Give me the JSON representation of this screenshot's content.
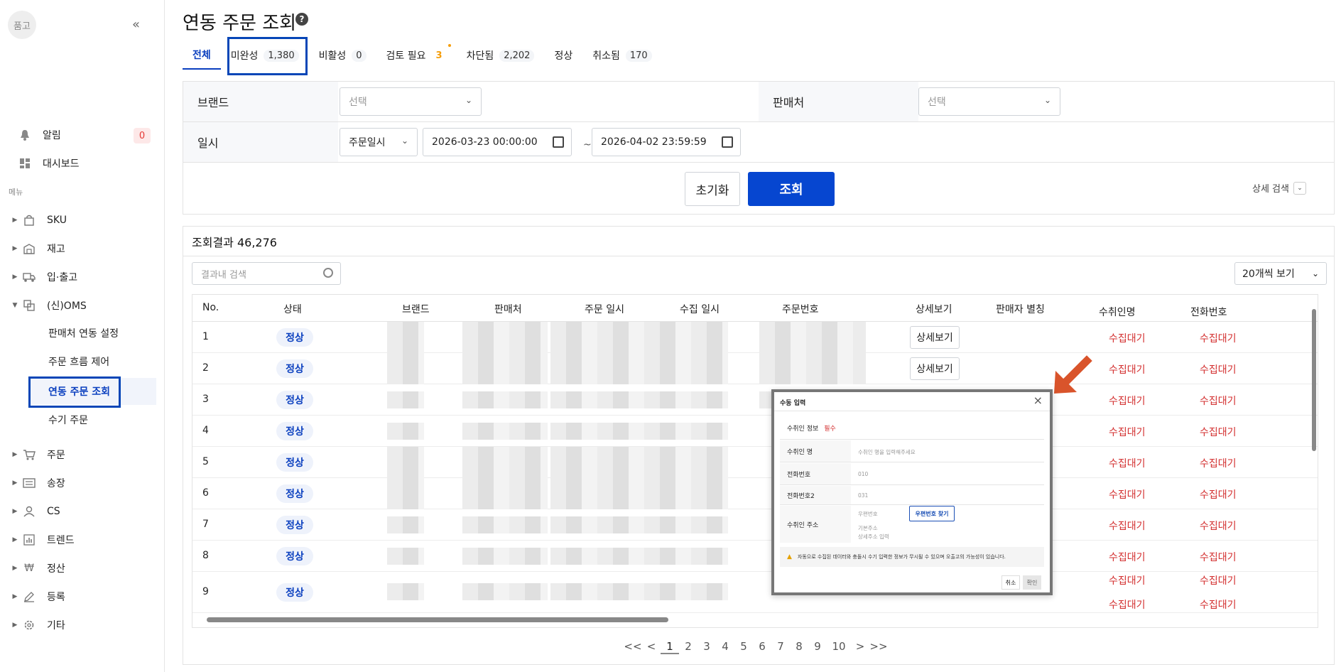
{
  "sidebar": {
    "logo": "품고",
    "collapse_label": "«",
    "alarm_label": "알림",
    "alarm_count": "0",
    "dashboard_label": "대시보드",
    "section_label": "메뉴",
    "items": [
      {
        "label": "SKU"
      },
      {
        "label": "재고"
      },
      {
        "label": "입·출고"
      },
      {
        "label": "(신)OMS"
      },
      {
        "label": "주문"
      },
      {
        "label": "송장"
      },
      {
        "label": "CS"
      },
      {
        "label": "트렌드"
      },
      {
        "label": "정산"
      },
      {
        "label": "등록"
      },
      {
        "label": "기타"
      }
    ],
    "oms_sub": [
      {
        "label": "판매처 연동 설정"
      },
      {
        "label": "주문 흐름 제어"
      },
      {
        "label": "연동 주문 조회"
      },
      {
        "label": "수기 주문"
      }
    ]
  },
  "page": {
    "title": "연동 주문 조회",
    "help_icon": "?"
  },
  "tabs": [
    {
      "label": "전체",
      "count": ""
    },
    {
      "label": "미완성",
      "count": "1,380"
    },
    {
      "label": "비활성",
      "count": "0"
    },
    {
      "label": "검토 필요",
      "count": "3"
    },
    {
      "label": "차단됨",
      "count": "2,202"
    },
    {
      "label": "정상",
      "count": ""
    },
    {
      "label": "취소됨",
      "count": "170"
    }
  ],
  "filter": {
    "brand_label": "브랜드",
    "brand_placeholder": "선택",
    "seller_label": "판매처",
    "seller_placeholder": "선택",
    "date_label": "일시",
    "date_type": "주문일시",
    "date_from": "2026-03-23 00:00:00",
    "date_to": "2026-04-02 23:59:59",
    "tilde": "~",
    "reset_label": "초기화",
    "search_label": "조회",
    "advanced_label": "상세 검색"
  },
  "result": {
    "title": "조회결과 46,276",
    "search_placeholder": "결과내 검색",
    "page_size": "20개씩 보기",
    "columns": [
      "No.",
      "상태",
      "브랜드",
      "판매처",
      "주문 일시",
      "수집 일시",
      "주문번호",
      "상세보기",
      "판매자 별칭",
      "수취인명",
      "전화번호"
    ],
    "rows": [
      {
        "no": "1",
        "status": "정상",
        "detail": "상세보기",
        "recv": "수집대기",
        "phone": "수집대기"
      },
      {
        "no": "2",
        "status": "정상",
        "detail": "상세보기",
        "recv": "수집대기",
        "phone": "수집대기"
      },
      {
        "no": "3",
        "status": "정상",
        "detail": "",
        "recv": "수집대기",
        "phone": "수집대기"
      },
      {
        "no": "4",
        "status": "정상",
        "detail": "",
        "recv": "수집대기",
        "phone": "수집대기"
      },
      {
        "no": "5",
        "status": "정상",
        "detail": "",
        "recv": "수집대기",
        "phone": "수집대기"
      },
      {
        "no": "6",
        "status": "정상",
        "detail": "",
        "recv": "수집대기",
        "phone": "수집대기"
      },
      {
        "no": "7",
        "status": "정상",
        "detail": "",
        "recv": "수집대기",
        "phone": "수집대기"
      },
      {
        "no": "8",
        "status": "정상",
        "detail": "",
        "recv": "수집대기",
        "phone": "수집대기"
      },
      {
        "no": "9",
        "status": "정상",
        "detail": "",
        "recv": "수집대기",
        "phone": "수집대기"
      }
    ],
    "extra_recv": "수집대기",
    "extra_phone": "수집대기"
  },
  "pager": [
    "<<",
    "<",
    "1",
    "2",
    "3",
    "4",
    "5",
    "6",
    "7",
    "8",
    "9",
    "10",
    ">",
    ">>"
  ],
  "modal": {
    "title": "수동 입력",
    "close": "×",
    "section": "수취인 정보",
    "required": "필수",
    "name_label": "수취인 명",
    "name_placeholder": "수취인 명을 입력해주세요",
    "phone_label": "전화번호",
    "phone_placeholder": "010",
    "phone2_label": "전화번호2",
    "phone2_placeholder": "031",
    "addr_label": "수취인 주소",
    "zip_placeholder": "우편번호",
    "zip_button": "우편번호 찾기",
    "addr1_placeholder": "기본주소",
    "addr2_placeholder": "상세주소 입력",
    "warning": "자동으로 수집된 데이터와 충돌시 수기 입력한 정보가 무시될 수 있으며 오출고의 가능성이 있습니다.",
    "cancel": "취소",
    "ok": "확인"
  }
}
